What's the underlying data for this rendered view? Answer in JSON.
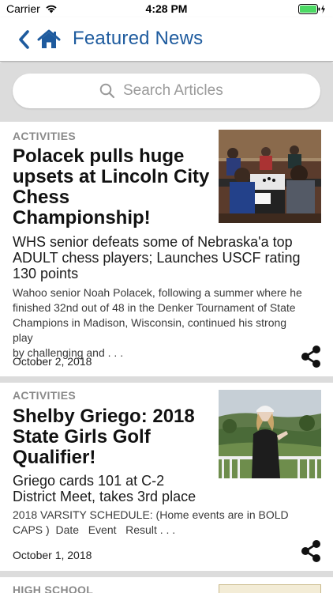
{
  "status": {
    "carrier": "Carrier",
    "time": "4:28 PM"
  },
  "nav": {
    "title": "Featured News",
    "accent_color": "#1e5b9e"
  },
  "search": {
    "placeholder": "Search Articles"
  },
  "articles": [
    {
      "category": "ACTIVITIES",
      "headline_lines": [
        "Polacek pulls huge",
        "upsets at Lincoln City",
        "Chess",
        "Championship!"
      ],
      "subhead_lines": [
        "WHS senior defeats some of Nebraska'a top",
        "ADULT chess players; Launches USCF rating",
        "130 points"
      ],
      "snippet_lines": [
        "Wahoo senior Noah Polacek, following a summer where he",
        "finished 32nd out of 48 in the Denker Tournament of State",
        "Champions in Madison, Wisconsin, continued his strong play",
        "by challenging and . . ."
      ],
      "date": "October 2, 2018",
      "image": "chess-tournament-photo"
    },
    {
      "category": "ACTIVITIES",
      "headline_lines": [
        "Shelby Griego: 2018",
        "State Girls Golf",
        "Qualifier!"
      ],
      "subhead_lines": [
        "Griego cards 101 at C-2",
        "District Meet, takes 3rd place"
      ],
      "snippet_lines": [
        "2018 VARSITY SCHEDULE: (Home events are in BOLD",
        "CAPS )  Date   Event   Result . . ."
      ],
      "date": "October 1, 2018",
      "image": "golf-course-photo"
    },
    {
      "category": "HIGH SCHOOL"
    }
  ],
  "icons": {
    "back": "chevron-left-icon",
    "home": "home-icon",
    "search": "magnifier-icon",
    "share": "share-icon",
    "wifi": "wifi-icon",
    "battery": "battery-icon"
  }
}
